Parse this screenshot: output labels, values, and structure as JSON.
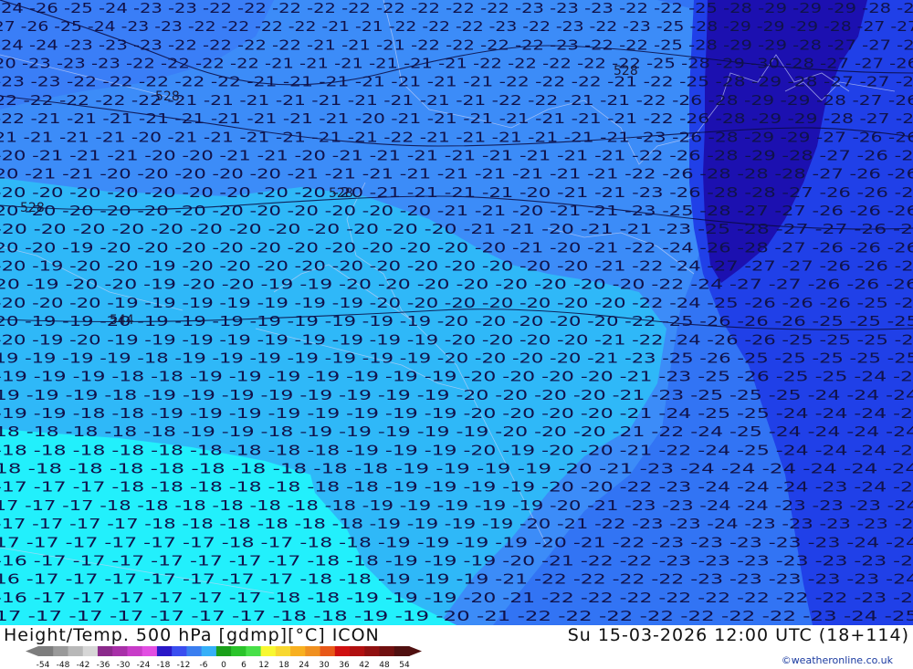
{
  "title": {
    "left": "Height/Temp. 500 hPa [gdmp][°C] ICON",
    "right": "Su 15-03-2026 12:00 UTC (18+114)"
  },
  "credit": "©weatheronline.co.uk",
  "legend": {
    "ticks": [
      "-54",
      "-48",
      "-42",
      "-36",
      "-30",
      "-24",
      "-18",
      "-12",
      "-6",
      "0",
      "6",
      "12",
      "18",
      "24",
      "30",
      "36",
      "42",
      "48",
      "54"
    ],
    "colors": [
      "#7d7d7d",
      "#9a9a9a",
      "#b8b8b8",
      "#d6d6d6",
      "#8b2a8b",
      "#a830a8",
      "#c83cc8",
      "#e24ee2",
      "#2a18c8",
      "#3a4ef0",
      "#3a7ef0",
      "#36b0f8",
      "#1aa01a",
      "#2ac42a",
      "#48e048",
      "#f8f830",
      "#f8d830",
      "#f8b020",
      "#f09020",
      "#e85818",
      "#d01010",
      "#b01010",
      "#901010",
      "#701010",
      "#501010"
    ]
  },
  "map": {
    "height_labels": [
      "528",
      "528",
      "528",
      "528",
      "544"
    ],
    "temperature_rows": [
      "-24 -26 -25 -24 -23 -23 -22 -22 -22 -22 -22 -22 -22 -22 -22 -23 -23 -23 -22 -22 -25 -28 -29 -29 -29 -28 -27",
      "-27 -26 -25 -24 -23 -23 -22 -22 -22 -22 -21 -21 -22 -22 -22 -23 -22 -23 -22 -23 -25 -28 -29 -29 -29 -28 -27 -27",
      "-24 -24 -23 -23 -23 -22 -22 -22 -22 -21 -21 -21 -22 -22 -22 -22 -23 -22 -22 -25 -28 -29 -29 -28 -27 -27 -26",
      "-20 -23 -23 -23 -22 -22 -22 -22 -21 -21 -21 -21 -21 -21 -22 -22 -22 -22 -22 -25 -28 -29 -30 -28 -27 -27 -26",
      "-23 -23 -22 -22 -22 -22 -22 -21 -21 -21 -21 -21 -21 -21 -22 -22 -22 -21 -22 -25 -28 -29 -28 -27 -27 -26",
      "-22 -22 -22 -22 -22 -21 -21 -21 -21 -21 -21 -21 -21 -21 -22 -22 -21 -21 -22 -26 -28 -29 -29 -28 -27 -26",
      "-22 -21 -21 -21 -21 -21 -21 -21 -21 -21 -20 -21 -21 -21 -21 -21 -21 -21 -22 -26 -28 -29 -29 -28 -27 -26",
      "-21 -21 -21 -21 -20 -21 -21 -21 -21 -21 -21 -22 -21 -21 -21 -21 -21 -21 -23 -26 -28 -29 -29 -27 -26 -26",
      "-20 -21 -21 -21 -20 -20 -21 -21 -20 -21 -21 -21 -21 -21 -21 -21 -21 -22 -26 -28 -29 -28 -27 -26 -26",
      "-20 -21 -21 -20 -20 -20 -20 -20 -21 -21 -21 -21 -21 -21 -21 -21 -21 -22 -26 -28 -28 -28 -27 -26 -26",
      "-20 -20 -20 -20 -20 -20 -20 -20 -20 -20 -21 -21 -21 -21 -20 -21 -21 -23 -26 -28 -28 -27 -26 -26 -26",
      "-20 -20 -20 -20 -20 -20 -20 -20 -20 -20 -20 -20 -21 -21 -20 -21 -21 -23 -25 -28 -27 -27 -26 -26 -26",
      "-20 -20 -20 -20 -20 -20 -20 -20 -20 -20 -20 -20 -21 -21 -20 -21 -21 -23 -25 -28 -27 -27 -26 -26",
      "-20 -20 -19 -20 -20 -20 -20 -20 -20 -20 -20 -20 -20 -20 -21 -20 -21 -22 -24 -26 -28 -27 -26 -26 -26",
      "-20 -19 -20 -20 -19 -20 -20 -20 -20 -20 -20 -20 -20 -20 -20 -20 -21 -22 -24 -27 -27 -27 -26 -26 -26",
      "-20 -19 -20 -20 -19 -20 -20 -19 -19 -20 -20 -20 -20 -20 -20 -20 -20 -22 -24 -27 -27 -26 -26 -26",
      "-20 -20 -20 -19 -19 -19 -19 -19 -19 -19 -20 -20 -20 -20 -20 -20 -20 -22 -24 -25 -26 -26 -26 -25 -25",
      "-20 -19 -19 -20 -19 -19 -19 -19 -19 -19 -19 -19 -20 -20 -20 -20 -20 -22 -25 -26 -26 -26 -25 -25 -25",
      "-20 -19 -20 -19 -19 -19 -19 -19 -19 -19 -19 -19 -20 -20 -20 -20 -21 -22 -24 -26 -26 -25 -25 -25 -25",
      "-19 -19 -19 -19 -18 -19 -19 -19 -19 -19 -19 -19 -20 -20 -20 -20 -21 -23 -25 -26 -25 -25 -25 -25 -25",
      "-19 -19 -19 -18 -18 -19 -19 -19 -19 -19 -19 -19 -20 -20 -20 -20 -21 -23 -25 -26 -25 -25 -24 -25",
      "-19 -19 -19 -18 -19 -19 -19 -19 -19 -19 -19 -19 -20 -20 -20 -20 -21 -23 -25 -25 -25 -24 -24 -24",
      "-19 -19 -18 -18 -19 -19 -19 -19 -19 -19 -19 -19 -20 -20 -20 -20 -21 -24 -25 -25 -24 -24 -24 -24",
      "-18 -18 -18 -18 -18 -19 -19 -18 -19 -19 -19 -19 -19 -20 -20 -20 -21 -22 -24 -25 -24 -24 -24 -24",
      "-18 -18 -18 -18 -18 -18 -18 -18 -18 -19 -19 -19 -20 -19 -20 -20 -21 -22 -24 -25 -24 -24 -24 -24",
      "-18 -18 -18 -18 -18 -18 -18 -18 -18 -18 -19 -19 -19 -19 -20 -21 -23 -24 -24 -24 -24 -24 -24",
      "-17 -17 -17 -18 -18 -18 -18 -18 -18 -18 -19 -19 -19 -19 -20 -20 -22 -23 -24 -24 -24 -23 -24 -24",
      "-17 -17 -17 -18 -18 -18 -18 -18 -18 -18 -19 -19 -19 -19 -19 -20 -21 -23 -23 -24 -24 -23 -23 -23 -24",
      "-17 -17 -17 -17 -18 -18 -18 -18 -18 -18 -19 -19 -19 -19 -20 -21 -22 -23 -23 -24 -23 -23 -23 -23 -24",
      "-17 -17 -17 -17 -17 -17 -18 -17 -18 -18 -19 -19 -19 -19 -20 -21 -22 -23 -23 -23 -23 -23 -24 -24",
      "-16 -17 -17 -17 -17 -17 -17 -17 -18 -18 -19 -19 -19 -20 -21 -22 -22 -23 -23 -23 -23 -23 -23 -24",
      "-16 -17 -17 -17 -17 -17 -17 -17 -18 -18 -19 -19 -19 -21 -22 -22 -22 -22 -23 -23 -23 -23 -23 -24",
      "-16 -17 -17 -17 -17 -17 -17 -18 -18 -19 -19 -19 -20 -21 -22 -22 -22 -22 -22 -22 -22 -22 -23 -24",
      "-17 -17 -17 -17 -17 -17 -17 -18 -18 -19 -19 -20 -21 -22 -22 -22 -22 -22 -22 -22 -23 -24 -25"
    ]
  }
}
